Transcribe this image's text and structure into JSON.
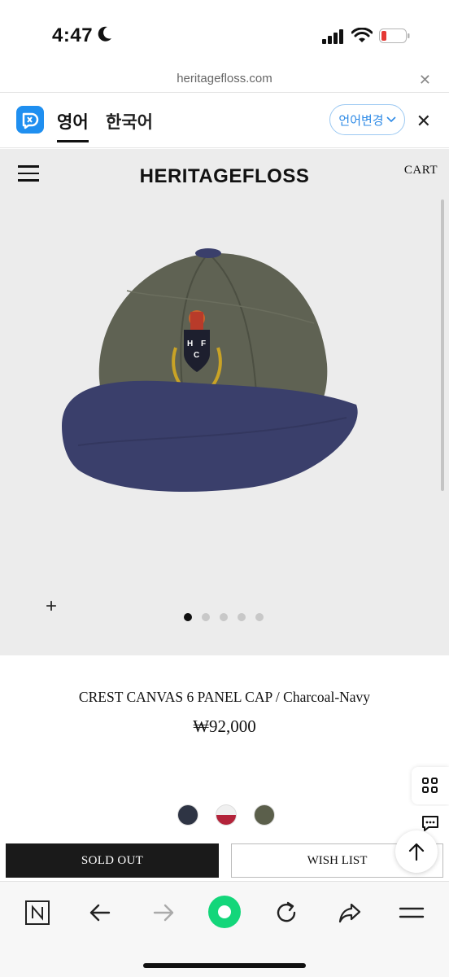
{
  "status": {
    "time": "4:47"
  },
  "browser": {
    "url": "heritagefloss.com"
  },
  "translate": {
    "tab_source": "영어",
    "tab_target": "한국어",
    "change_label": "언어변경"
  },
  "site": {
    "brand": "HERITAGEFLOSS",
    "cart_label": "CART"
  },
  "product": {
    "title": "CREST CANVAS 6 PANEL CAP / Charcoal-Navy",
    "price": "₩92,000",
    "image_count": 5,
    "active_image": 1,
    "swatches": [
      {
        "name": "navy",
        "color": "#2e3444"
      },
      {
        "name": "white-red",
        "color": "#e8e8e8"
      },
      {
        "name": "olive",
        "color": "#5b5f4b"
      }
    ]
  },
  "actions": {
    "sold_out_label": "SOLD OUT",
    "wishlist_label": "WISH LIST"
  },
  "colors": {
    "accent_blue": "#2d8ae6",
    "nav_green": "#13d67a",
    "button_dark": "#1a1a1a"
  }
}
